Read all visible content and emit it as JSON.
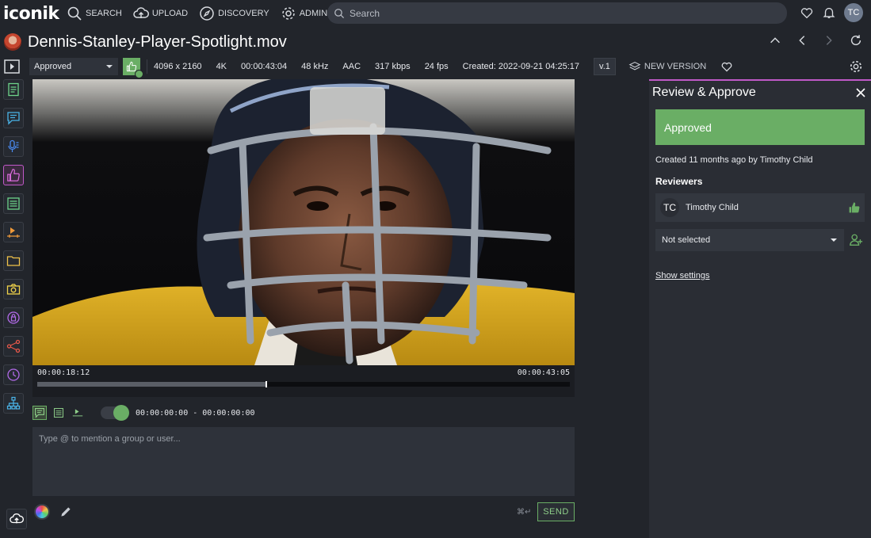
{
  "nav": {
    "logo": "iconik",
    "items": [
      {
        "label": "SEARCH",
        "icon": "search-icon"
      },
      {
        "label": "UPLOAD",
        "icon": "cloud-upload-icon"
      },
      {
        "label": "DISCOVERY",
        "icon": "compass-icon"
      },
      {
        "label": "ADMIN",
        "icon": "gear-icon"
      }
    ],
    "search_placeholder": "Search",
    "user_initials": "TC"
  },
  "asset": {
    "title": "Dennis-Stanley-Player-Spotlight.mov"
  },
  "meta": {
    "status": "Approved",
    "resolution": "4096 x 2160",
    "quality": "4K",
    "duration": "00:00:43:04",
    "sample_rate": "48 kHz",
    "codec": "AAC",
    "bitrate": "317 kbps",
    "fps": "24 fps",
    "created": "Created: 2022-09-21 04:25:17",
    "version": "v.1",
    "new_version": "NEW VERSION"
  },
  "player": {
    "current_tc": "00:00:18:12",
    "total_tc": "00:00:43:05",
    "progress": 0.428
  },
  "comment": {
    "range": "00:00:00:00 - 00:00:00:00",
    "placeholder": "Type @ to mention a group or user...",
    "shortcut": "⌘↵",
    "send": "SEND"
  },
  "panel": {
    "title": "Review & Approve",
    "status": "Approved",
    "created_prefix": "Created 11 months ago by",
    "created_by": "Timothy Child",
    "reviewers_label": "Reviewers",
    "reviewer_initials": "TC",
    "reviewer_name": "Timothy Child",
    "select_value": "Not selected",
    "show_settings": "Show settings"
  },
  "colors": {
    "accent_green": "#6aae65",
    "accent_purple": "#c059c8",
    "background": "#22252b"
  }
}
